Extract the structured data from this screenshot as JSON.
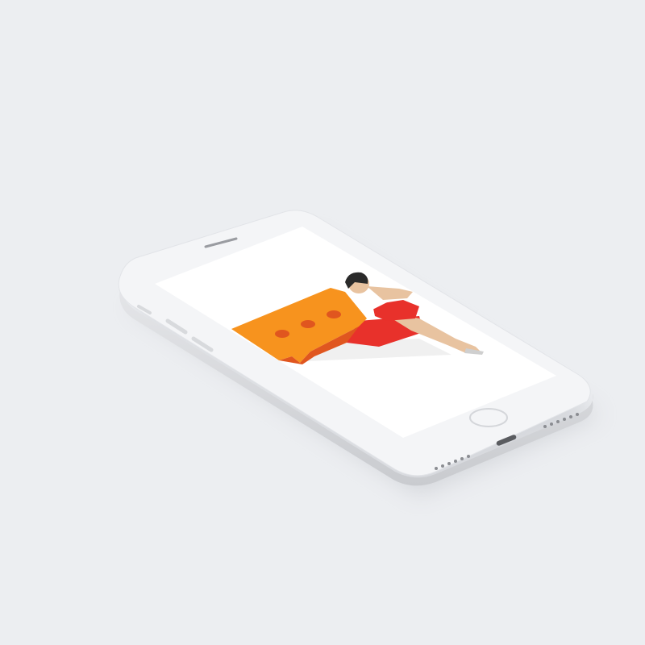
{
  "scene": {
    "background_color": "#eceef1",
    "device": "smartphone-mockup",
    "device_color": "#f4f5f7",
    "screen_color": "#ffffff"
  },
  "illustration": {
    "subject": "woman-reclining-on-chat-bubble",
    "bubble_color": "#f7931e",
    "bubble_dot_color": "#e0561f",
    "accent_red": "#e8312b",
    "skin_color": "#e8c3a0",
    "hair_color": "#2a2a2a",
    "dot_count": 3
  }
}
